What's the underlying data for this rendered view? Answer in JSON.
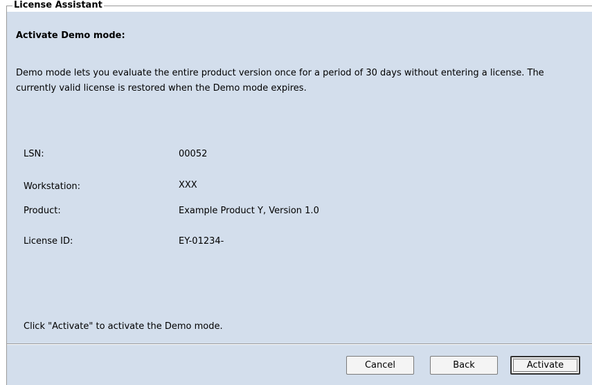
{
  "window": {
    "group_title": "License Assistant"
  },
  "main": {
    "heading": "Activate Demo mode:",
    "description": "Demo mode lets you evaluate the entire product version once for a period of 30 days without entering a license. The currently valid license is restored when the Demo mode expires.",
    "info": [
      {
        "label": "LSN:",
        "value": "00052"
      },
      {
        "label": "Workstation:",
        "value": "XXX"
      },
      {
        "label": "Product:",
        "value": "Example Product Y, Version  1.0"
      },
      {
        "label": "License ID:",
        "value": "EY-01234-"
      }
    ],
    "instruction": "Click \"Activate\" to activate the Demo mode."
  },
  "buttons": {
    "cancel": "Cancel",
    "back": "Back",
    "activate": "Activate"
  },
  "colors": {
    "panel_background": "#d3deec",
    "border": "#9a9a9a"
  }
}
